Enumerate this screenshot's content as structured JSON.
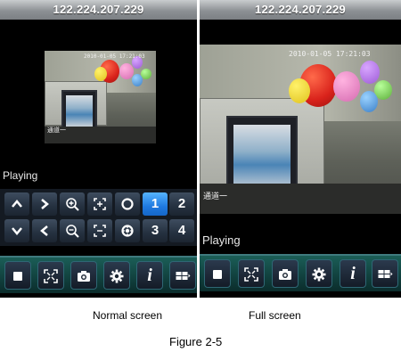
{
  "normal": {
    "ip": "122.224.207.229",
    "status": "Playing",
    "timestamp": "2010-01-05 17:21:03",
    "channel_label": "通道一",
    "keypad": {
      "row1": [
        {
          "icon": "chevron-up-icon"
        },
        {
          "icon": "chevron-right-icon"
        },
        {
          "icon": "zoom-in-icon"
        },
        {
          "icon": "focus-near-icon"
        },
        {
          "icon": "iris-open-icon"
        },
        {
          "label": "1",
          "selected": true
        },
        {
          "label": "2"
        }
      ],
      "row2": [
        {
          "icon": "chevron-down-icon"
        },
        {
          "icon": "chevron-left-icon"
        },
        {
          "icon": "zoom-out-icon"
        },
        {
          "icon": "focus-far-icon"
        },
        {
          "icon": "iris-close-icon"
        },
        {
          "label": "3"
        },
        {
          "label": "4"
        }
      ]
    }
  },
  "full": {
    "ip": "122.224.207.229",
    "status": "Playing",
    "timestamp": "2010-01-05 17:21:03",
    "channel_label": "通道一"
  },
  "toolbar": {
    "buttons": [
      {
        "icon": "stop-icon"
      },
      {
        "icon": "fullscreen-icon"
      },
      {
        "icon": "camera-icon"
      },
      {
        "icon": "gear-icon"
      },
      {
        "icon": "info-icon",
        "text": "i"
      },
      {
        "icon": "layout-icon"
      }
    ]
  },
  "captions": {
    "left": "Normal screen",
    "right": "Full screen",
    "figure": "Figure 2-5"
  },
  "colors": {
    "toolbar": "#0f3b39",
    "key": "#253140",
    "key_selected": "#1f7ae0"
  }
}
